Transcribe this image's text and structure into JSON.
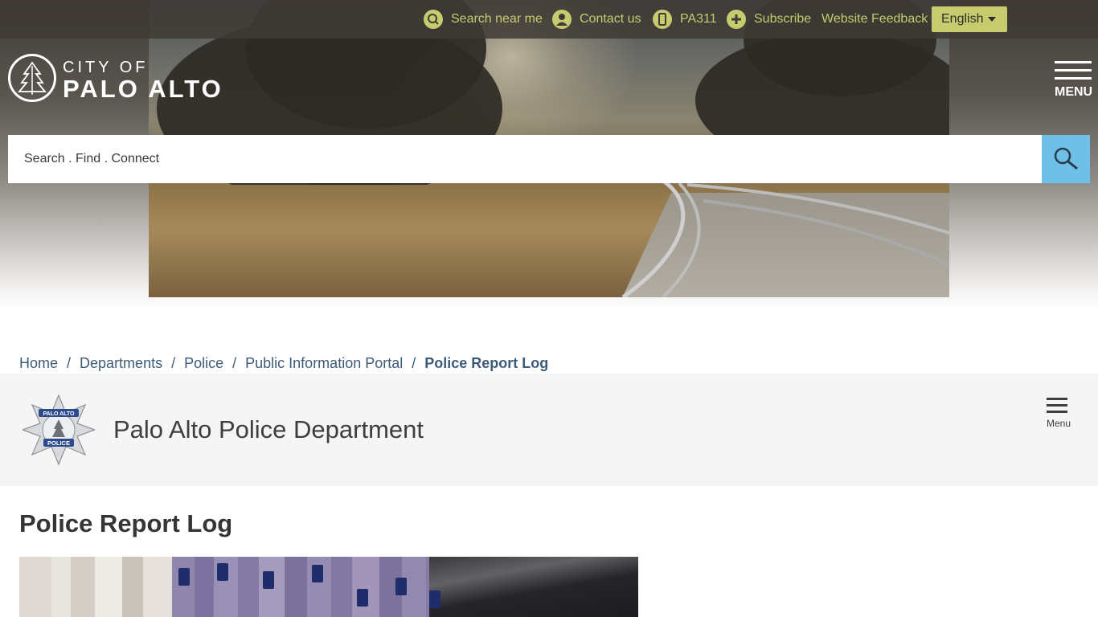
{
  "utility_bar": {
    "items": [
      {
        "label": "Search near me",
        "icon": "location-search-icon"
      },
      {
        "label": "Contact us",
        "icon": "person-icon"
      },
      {
        "label": "PA311",
        "icon": "phone-icon"
      },
      {
        "label": "Subscribe",
        "icon": "plus-circle-icon"
      },
      {
        "label": "Website Feedback",
        "icon": ""
      }
    ],
    "language": {
      "selected": "English"
    }
  },
  "logo": {
    "line1": "CITY OF",
    "line2": "PALO ALTO"
  },
  "main_menu": {
    "label": "MENU"
  },
  "search": {
    "placeholder": "Search . Find . Connect"
  },
  "breadcrumb": {
    "items": [
      "Home",
      "Departments",
      "Police",
      "Public Information Portal"
    ],
    "current": "Police Report Log",
    "separator": "/"
  },
  "department": {
    "title": "Palo Alto Police Department",
    "menu_label": "Menu",
    "badge_top": "PALO ALTO",
    "badge_bottom": "POLICE"
  },
  "page": {
    "title": "Police Report Log"
  },
  "colors": {
    "accent": "#c6cc6e",
    "link": "#3d5a78",
    "search_button": "#6ec0e8"
  }
}
